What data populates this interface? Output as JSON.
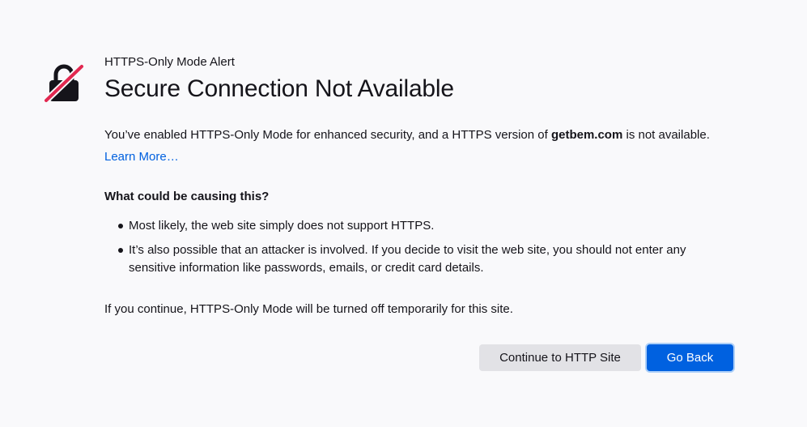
{
  "alert": {
    "eyebrow": "HTTPS-Only Mode Alert",
    "title": "Secure Connection Not Available",
    "icon": "lock-broken-icon",
    "icon_color": "#e22850"
  },
  "intro": {
    "before": "You’ve enabled HTTPS-Only Mode for enhanced security, and a HTTPS version of ",
    "domain": "getbem.com",
    "after": " is not available."
  },
  "learn_more": "Learn More…",
  "causes": {
    "heading": "What could be causing this?",
    "items": [
      "Most likely, the web site simply does not support HTTPS.",
      "It’s also possible that an attacker is involved. If you decide to visit the web site, you should not enter any sensitive information like passwords, emails, or credit card details."
    ]
  },
  "footer_note": "If you continue, HTTPS-Only Mode will be turned off temporarily for this site.",
  "buttons": {
    "continue_label": "Continue to HTTP Site",
    "go_back_label": "Go Back"
  },
  "colors": {
    "accent": "#0061e0",
    "link": "#0060df",
    "background": "#f9f9fb"
  }
}
